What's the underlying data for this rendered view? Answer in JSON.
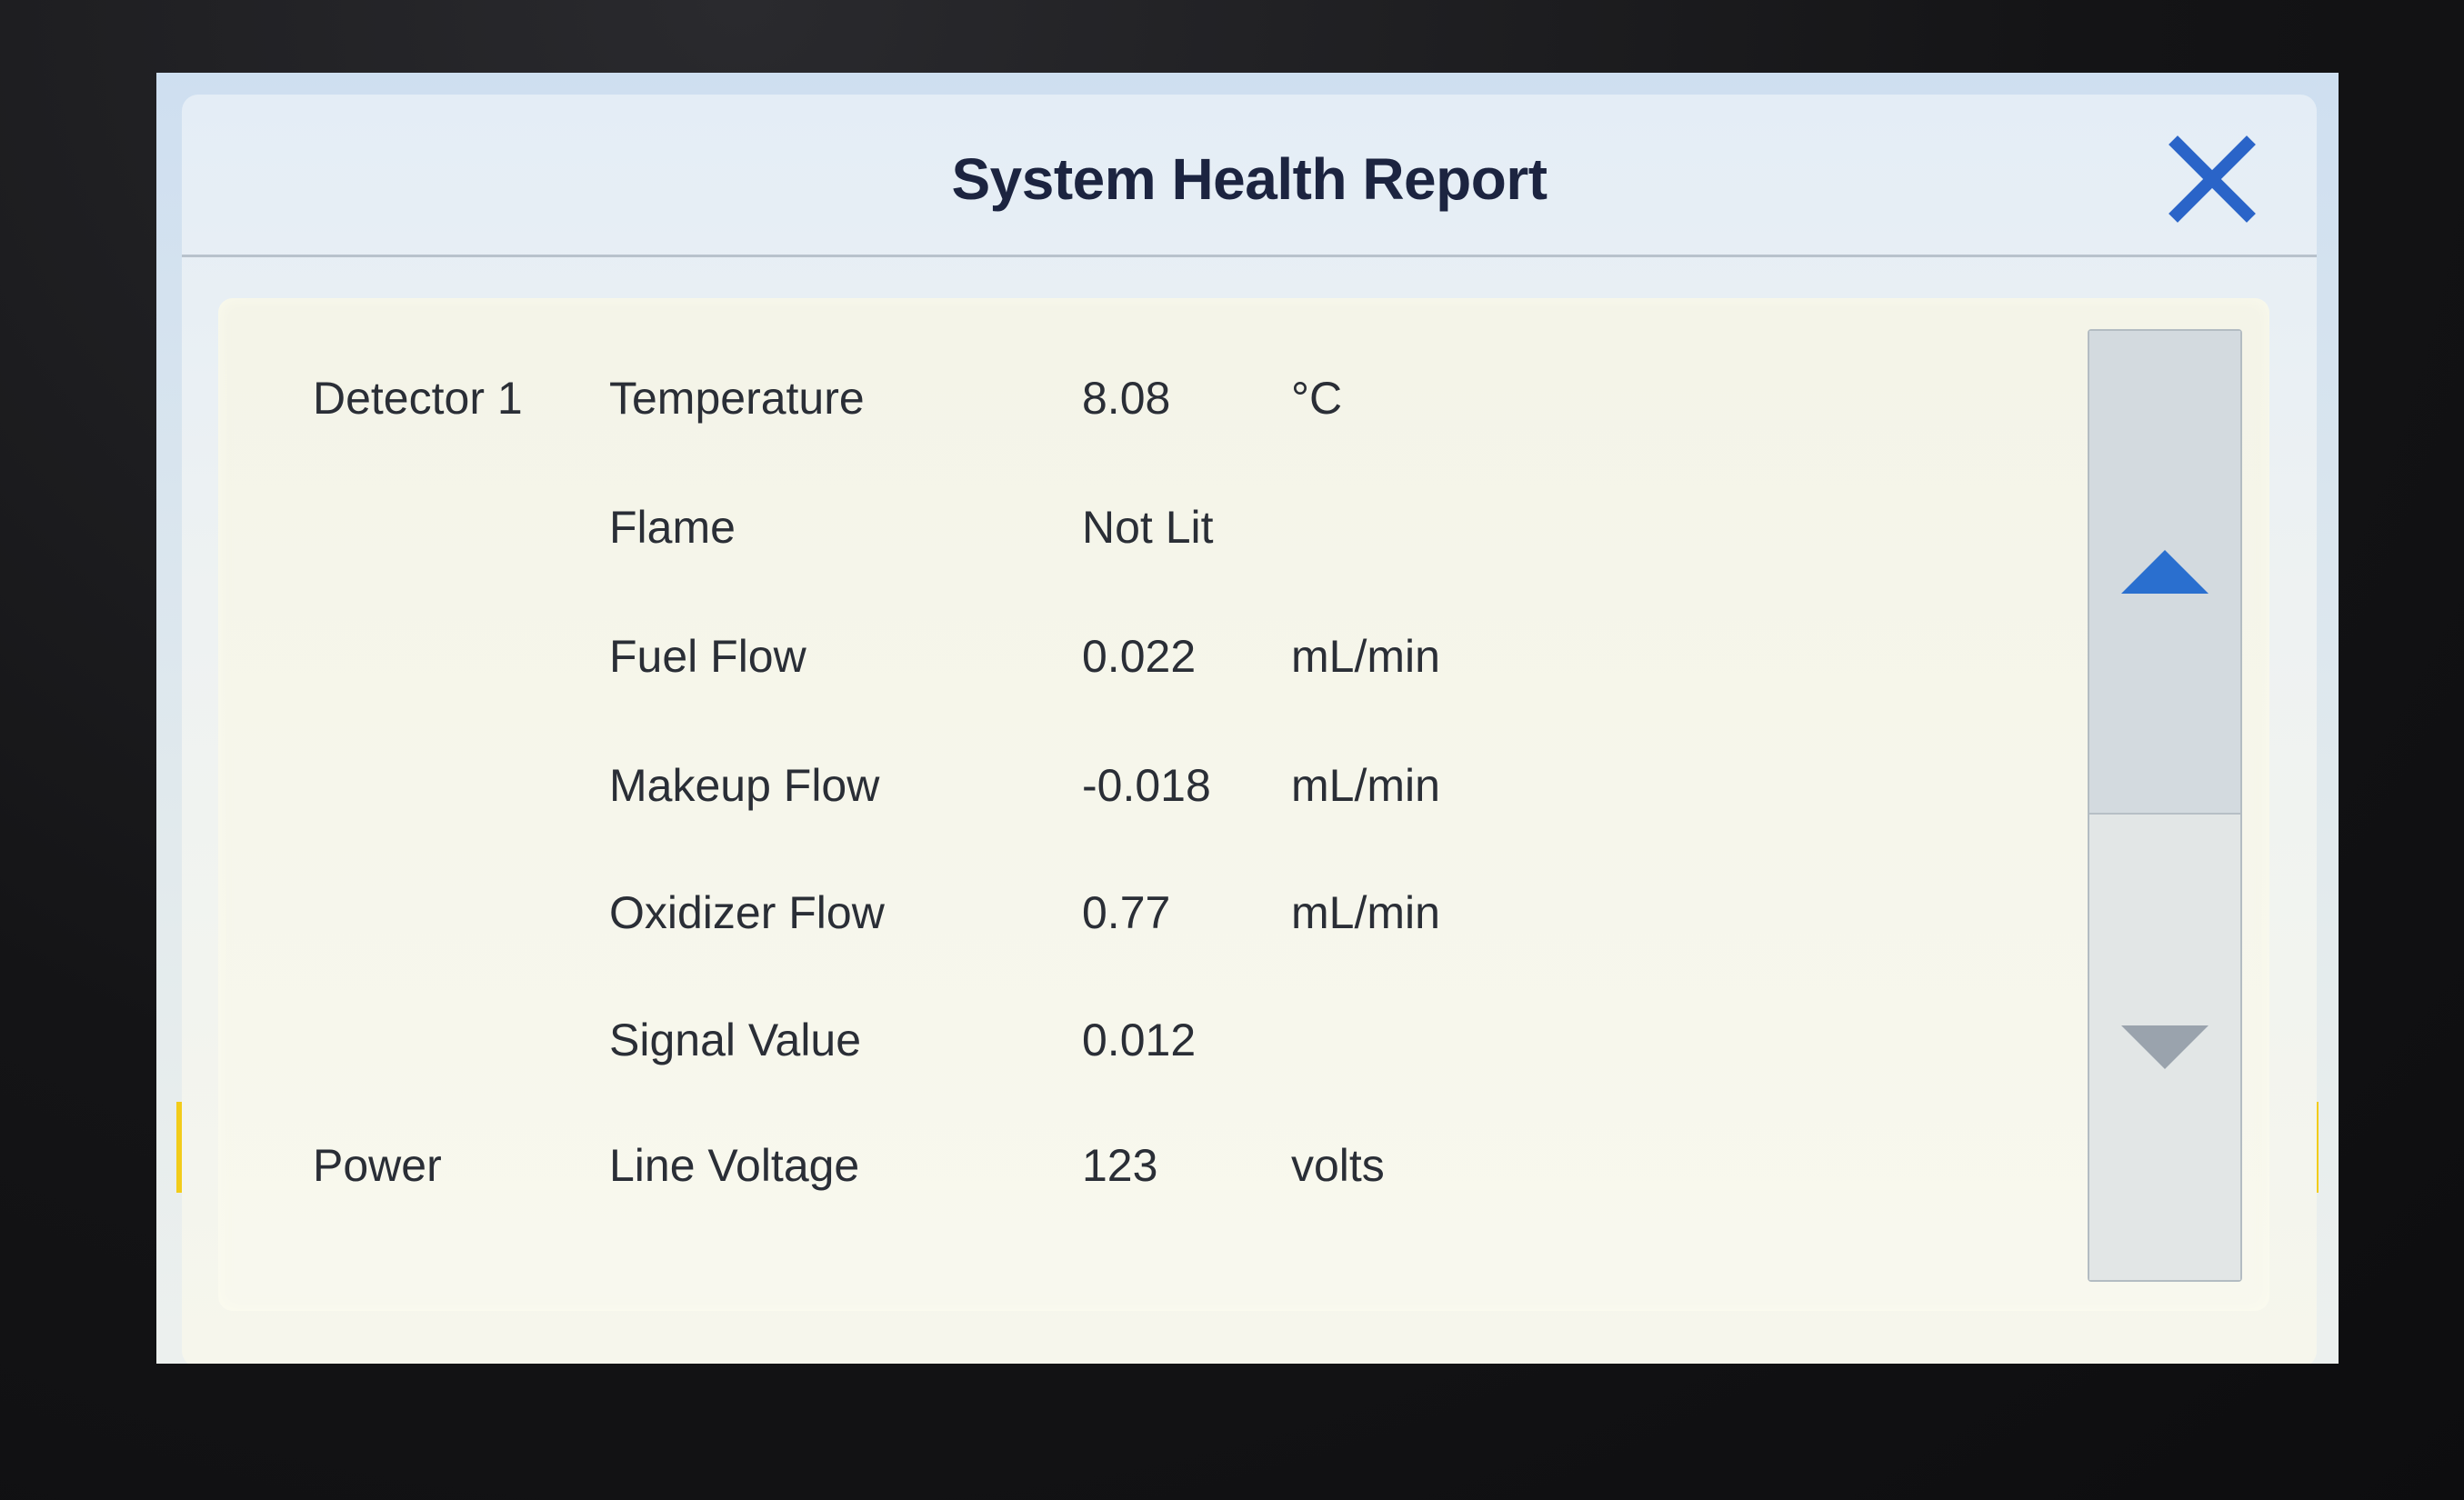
{
  "dialog": {
    "title": "System Health Report"
  },
  "rows": [
    {
      "group": "Detector 1",
      "parameter": "Temperature",
      "value": "8.08",
      "unit": "°C"
    },
    {
      "group": "",
      "parameter": "Flame",
      "value": "Not Lit",
      "unit": ""
    },
    {
      "group": "",
      "parameter": "Fuel Flow",
      "value": "0.022",
      "unit": "mL/min"
    },
    {
      "group": "",
      "parameter": "Makeup Flow",
      "value": "-0.018",
      "unit": "mL/min"
    },
    {
      "group": "",
      "parameter": "Oxidizer Flow",
      "value": "0.77",
      "unit": "mL/min"
    },
    {
      "group": "",
      "parameter": "Signal Value",
      "value": "0.012",
      "unit": ""
    },
    {
      "group": "Power",
      "parameter": "Line Voltage",
      "value": "123",
      "unit": "volts"
    }
  ],
  "icons": {
    "close": "close-icon",
    "scroll_up": "triangle-up-icon",
    "scroll_down": "triangle-down-icon"
  },
  "colors": {
    "close_icon": "#2a64c8",
    "scroll_up_icon": "#2a6fcf",
    "scroll_down_icon": "#9aa3ad",
    "title_text": "#1c2440",
    "accent_yellow": "#f2cc1a"
  }
}
